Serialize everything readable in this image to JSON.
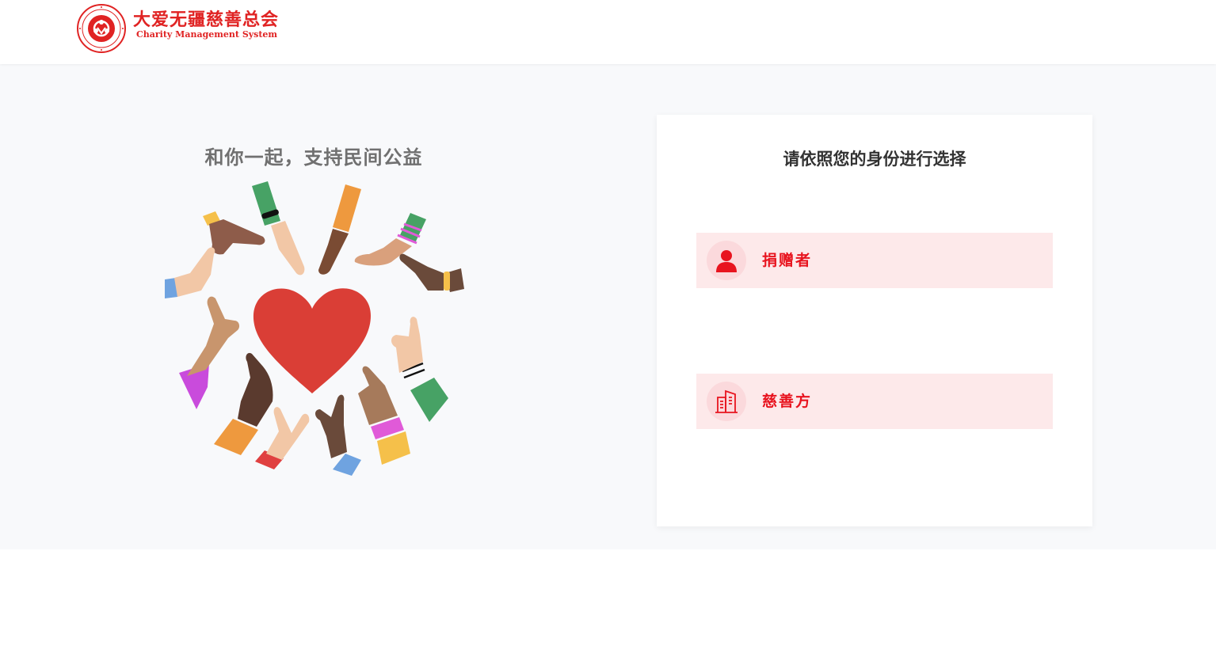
{
  "header": {
    "org_name": "大爱无疆慈善总会",
    "org_subtitle": "Charity Management System"
  },
  "hero": {
    "slogan": "和你一起，支持民间公益",
    "illustration_icon": "heart-surrounded-by-hands"
  },
  "identity_card": {
    "title": "请依照您的身份进行选择",
    "options": [
      {
        "label": "捐赠者",
        "icon": "person-icon"
      },
      {
        "label": "慈善方",
        "icon": "building-icon"
      }
    ]
  },
  "colors": {
    "brand_red": "#e8141f",
    "option_bg": "#fde9ea",
    "icon_bg": "#fbd9dc",
    "page_bg": "#f8f9fb"
  }
}
